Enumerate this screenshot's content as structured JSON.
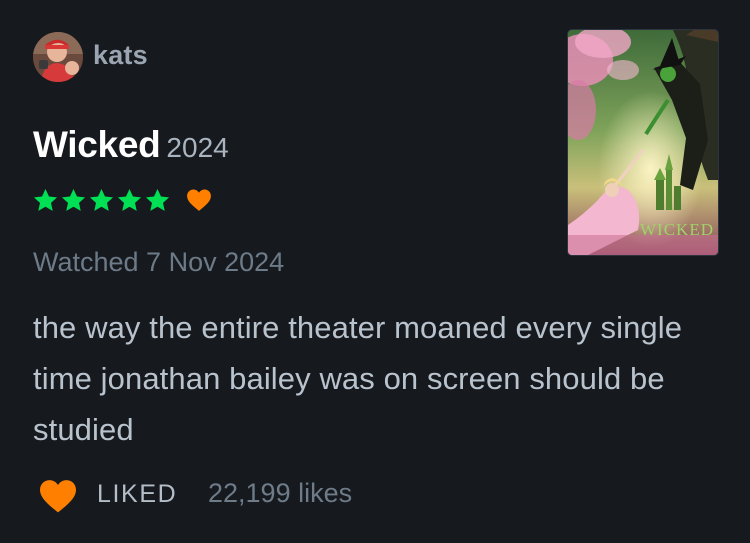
{
  "user": {
    "name": "kats"
  },
  "film": {
    "title": "Wicked",
    "year": "2024",
    "poster_wordmark": "WICKED"
  },
  "rating": {
    "stars": 5,
    "max_stars": 5,
    "liked": true
  },
  "diary": {
    "watched_text": "Watched 7 Nov 2024"
  },
  "review": {
    "text": "the way the entire theater moaned every single time jonathan bailey was on screen should be studied"
  },
  "footer": {
    "liked_label": "LIKED",
    "likes_text": "22,199 likes"
  },
  "colors": {
    "background": "#16191e",
    "star_green": "#00e054",
    "heart_orange": "#ff8000",
    "muted_text": "#6d7a87",
    "body_text": "#b9c3cd"
  },
  "icons": {
    "star": "star-icon",
    "like": "heart-icon",
    "liked_badge": "heart-small-icon"
  }
}
